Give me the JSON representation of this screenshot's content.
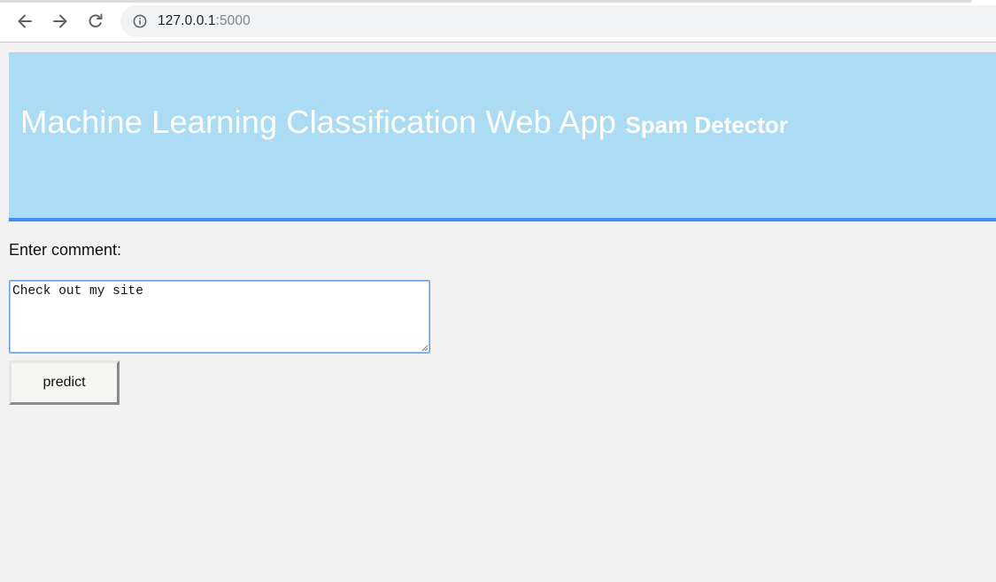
{
  "browser": {
    "url_host": "127.0.0.1",
    "url_port": ":5000"
  },
  "header": {
    "title": "Machine Learning Classification Web App",
    "subtitle": "Spam Detector"
  },
  "form": {
    "prompt_label": "Enter comment:",
    "comment_value": "Check out my site",
    "submit_label": "predict"
  },
  "icons": {
    "back": "arrow-left-icon",
    "forward": "arrow-right-icon",
    "reload": "reload-icon",
    "site_info": "info-icon",
    "resize": "resize-grip-icon"
  },
  "colors": {
    "banner_background": "#abdcf3",
    "banner_border": "#3f8ef8",
    "page_background": "#f2f2f2",
    "title_text": "#ffffff"
  }
}
